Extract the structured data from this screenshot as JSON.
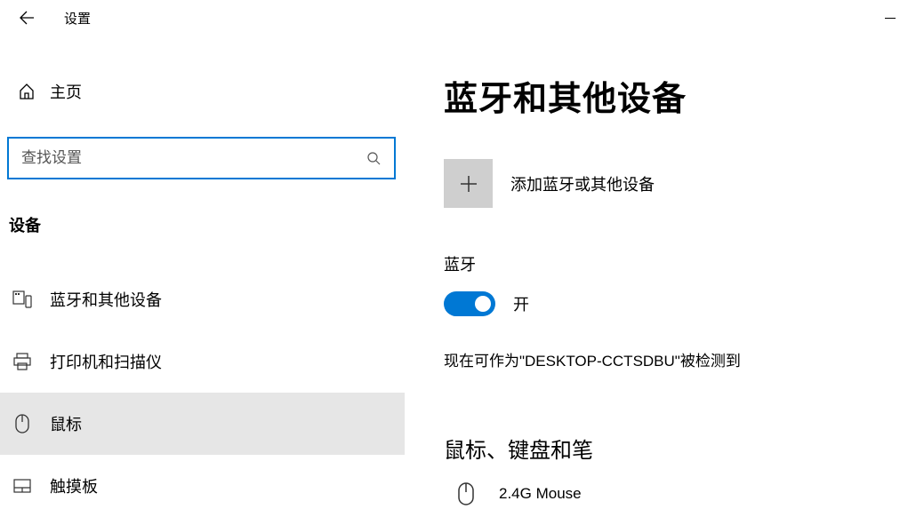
{
  "titlebar": {
    "title": "设置"
  },
  "sidebar": {
    "home": "主页",
    "search_placeholder": "查找设置",
    "category": "设备",
    "items": [
      {
        "label": "蓝牙和其他设备",
        "icon": "devices-icon"
      },
      {
        "label": "打印机和扫描仪",
        "icon": "printer-icon"
      },
      {
        "label": "鼠标",
        "icon": "mouse-icon"
      },
      {
        "label": "触摸板",
        "icon": "touchpad-icon"
      }
    ]
  },
  "content": {
    "title": "蓝牙和其他设备",
    "add_device": "添加蓝牙或其他设备",
    "bluetooth_label": "蓝牙",
    "toggle_state": "开",
    "discoverable": "现在可作为\"DESKTOP-CCTSDBU\"被检测到",
    "section_title": "鼠标、键盘和笔",
    "devices": [
      {
        "name": "2.4G Mouse",
        "icon": "mouse-icon"
      }
    ]
  }
}
